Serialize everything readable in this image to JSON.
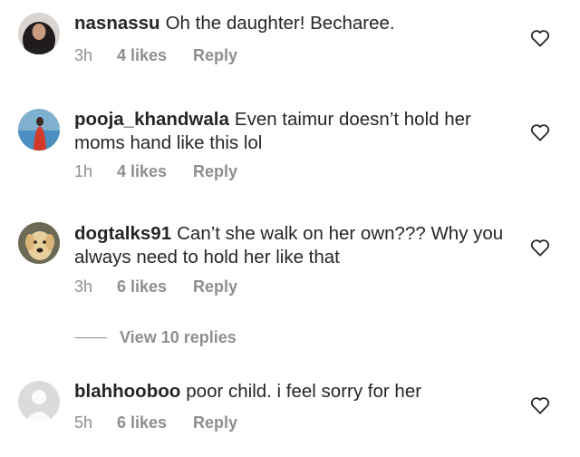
{
  "comments": [
    {
      "username": "nasnassu",
      "text": "Oh the daughter! Becharee.",
      "time": "3h",
      "likes": "4 likes",
      "reply": "Reply",
      "avatar_icon": "user-photo-hijab"
    },
    {
      "username": "pooja_khandwala",
      "text": "Even taimur doesn’t hold her moms hand like this lol",
      "time": "1h",
      "likes": "4 likes",
      "reply": "Reply",
      "avatar_icon": "user-photo-pool"
    },
    {
      "username": "dogtalks91",
      "text": "Can’t she walk on her own??? Why you always need to hold her like that",
      "time": "3h",
      "likes": "6 likes",
      "reply": "Reply",
      "avatar_icon": "user-photo-dog"
    },
    {
      "username": "blahhooboo",
      "text": "poor child. i feel sorry for her",
      "time": "5h",
      "likes": "6 likes",
      "reply": "Reply",
      "avatar_icon": "default-avatar"
    }
  ],
  "view_replies": "View 10 replies",
  "colors": {
    "text": "#262626",
    "muted": "#8e8e8e",
    "heart_stroke": "#262626"
  }
}
